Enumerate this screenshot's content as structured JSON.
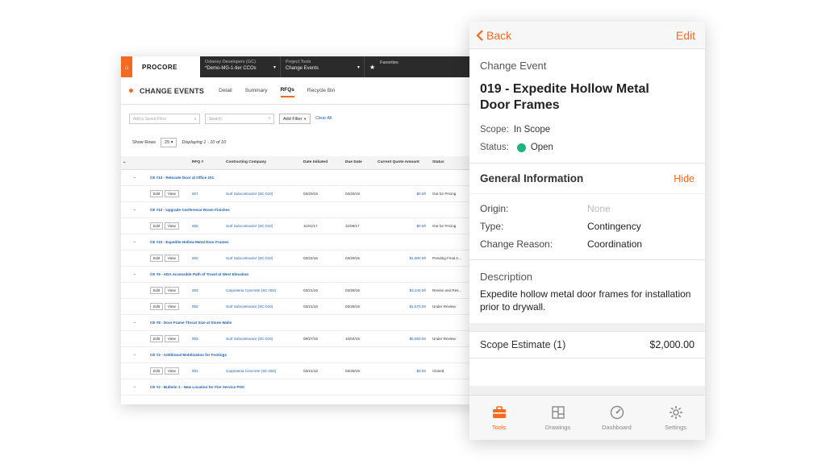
{
  "desktop": {
    "logo": "PROCORE",
    "company_label": "Oxlaney Developers (GC)",
    "company_value": "*Demo-MG-1-tier CCOs",
    "tools_label": "Project Tools",
    "tools_value": "Change Events",
    "favorites_label": "Favorites",
    "page_title": "CHANGE EVENTS",
    "tabs": [
      "Detail",
      "Summary",
      "RFQs",
      "Recycle Bin"
    ],
    "active_tab": "RFQs",
    "filter_placeholder": "Add a Saved Filter",
    "search_placeholder": "Search",
    "add_filter": "Add Filter",
    "clear_all": "Clear All",
    "show_rows_label": "Show Rows",
    "show_rows_value": "25",
    "displaying": "Displaying 1 - 10 of 10",
    "columns": [
      "RFQ #",
      "Contracting Company",
      "Date Initiated",
      "Due Date",
      "Current Quote Amount",
      "Status"
    ],
    "edit_label": "Edit",
    "view_label": "View",
    "groups": [
      {
        "title": "CE #13 - Relocate Door at Office 101",
        "rows": [
          {
            "rfq": "007",
            "company": "Surf Subcontractor (SC-010)",
            "initiated": "03/20/18",
            "due": "03/29/18",
            "amount": "$0.00",
            "status": "Out for Pricing"
          }
        ]
      },
      {
        "title": "CE #12 - Upgrade Conference Room Finishes",
        "rows": [
          {
            "rfq": "006",
            "company": "Surf Subcontractor (SC-010)",
            "initiated": "11/01/17",
            "due": "11/08/17",
            "amount": "$0.00",
            "status": "Out for Pricing"
          }
        ]
      },
      {
        "title": "CE #10 - Expedite Hollow Metal Door Frames",
        "rows": [
          {
            "rfq": "002",
            "company": "Surf Subcontractor (SC-010)",
            "initiated": "03/22/16",
            "due": "03/29/16",
            "amount": "$1,600.00",
            "status": "Pending Final A..."
          }
        ]
      },
      {
        "title": "CE #9 - ADA Accessible Path of Travel at West Elevation",
        "rows": [
          {
            "rfq": "003",
            "company": "Carpinteria Concrete (SC-002)",
            "initiated": "03/21/16",
            "due": "03/28/16",
            "amount": "$3,240.00",
            "status": "Revise and Res..."
          },
          {
            "rfq": "002",
            "company": "Surf Subcontractor (SC-010)",
            "initiated": "03/21/16",
            "due": "03/28/16",
            "amount": "$1,570.00",
            "status": "Under Review"
          }
        ]
      },
      {
        "title": "CE #8 - Door Frame Throat Size at Stone Walls",
        "rows": [
          {
            "rfq": "003",
            "company": "Surf Subcontractor (SC-010)",
            "initiated": "09/27/18",
            "due": "10/04/16",
            "amount": "$5,500.00",
            "status": "Under Review"
          }
        ]
      },
      {
        "title": "CE #3 - Additional Mobilization for Footings",
        "rows": [
          {
            "rfq": "001",
            "company": "Carpinteria Concrete (SC-002)",
            "initiated": "03/21/16",
            "due": "03/28/16",
            "amount": "$0.00",
            "status": "Closed"
          }
        ]
      },
      {
        "title": "CE #2 - Bulletin 1 - New Location for Fire Service POC",
        "rows": []
      }
    ]
  },
  "mobile": {
    "back_label": "Back",
    "edit_label": "Edit",
    "section_label": "Change Event",
    "title": "019 - Expedite Hollow Metal Door Frames",
    "scope_key": "Scope:",
    "scope_value": "In Scope",
    "status_key": "Status:",
    "status_value": "Open",
    "status_color": "#1fb37e",
    "general_title": "General Information",
    "hide_label": "Hide",
    "origin_key": "Origin:",
    "origin_value": "None",
    "type_key": "Type:",
    "type_value": "Contingency",
    "reason_key": "Change Reason:",
    "reason_value": "Coordination",
    "description_title": "Description",
    "description_text": "Expedite hollow metal door frames for installation prior to drywall.",
    "estimate_key": "Scope Estimate (1)",
    "estimate_value": "$2,000.00",
    "tabs": [
      {
        "label": "Tools",
        "icon": "toolbox-icon",
        "active": true
      },
      {
        "label": "Drawings",
        "icon": "drawings-icon",
        "active": false
      },
      {
        "label": "Dashboard",
        "icon": "dashboard-icon",
        "active": false
      },
      {
        "label": "Settings",
        "icon": "gear-icon",
        "active": false
      }
    ],
    "accent_color": "#f36a20"
  }
}
